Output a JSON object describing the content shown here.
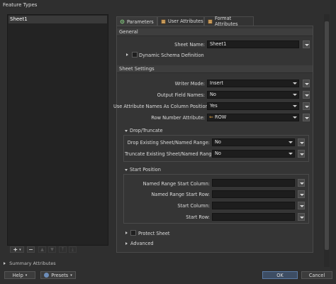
{
  "window": {
    "title": "Feature Types"
  },
  "left": {
    "items": [
      "Sheet1"
    ],
    "buttons": {
      "add": "+",
      "remove": "−"
    }
  },
  "summary": "Summary Attributes",
  "tabs": [
    {
      "label": "Parameters",
      "icon": "gear-icon"
    },
    {
      "label": "User Attributes",
      "icon": "user-attributes-icon"
    },
    {
      "label": "Format Attributes",
      "icon": "format-attributes-icon"
    }
  ],
  "general": {
    "heading": "General",
    "sheet_name_label": "Sheet Name:",
    "sheet_name_value": "Sheet1",
    "dynamic_schema_label": "Dynamic Schema Definition"
  },
  "sheet_settings": {
    "heading": "Sheet Settings",
    "writer_mode_label": "Writer Mode:",
    "writer_mode_value": "Insert",
    "output_field_names_label": "Output Field Names:",
    "output_field_names_value": "No",
    "use_attr_names_label": "Use Attribute Names As Column Positions:",
    "use_attr_names_value": "Yes",
    "row_number_label": "Row Number Attribute:",
    "row_number_value": "ROW"
  },
  "drop_truncate": {
    "heading": "Drop/Truncate",
    "drop_label": "Drop Existing Sheet/Named Range:",
    "drop_value": "No",
    "truncate_label": "Truncate Existing Sheet/Named Range:",
    "truncate_value": "No"
  },
  "start_position": {
    "heading": "Start Position",
    "named_col_label": "Named Range Start Column:",
    "named_row_label": "Named Range Start Row:",
    "start_col_label": "Start Column:",
    "start_row_label": "Start Row:"
  },
  "protect_sheet_label": "Protect Sheet",
  "advanced_label": "Advanced",
  "footer": {
    "help": "Help",
    "presets": "Presets",
    "ok": "OK",
    "cancel": "Cancel"
  }
}
